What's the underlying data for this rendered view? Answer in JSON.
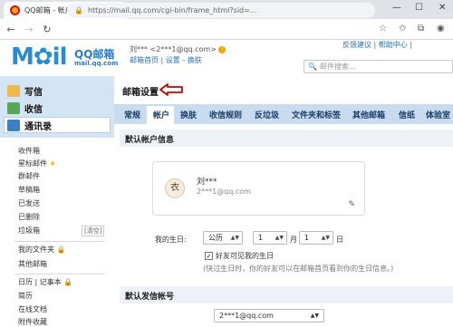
{
  "browser": {
    "tab_title": "QQ邮箱 - 帐户",
    "url": "https://mail.qq.com/cgi-bin/frame_html?sid=...",
    "icons": [
      "back-icon",
      "forward-icon",
      "reload-icon",
      "lock-icon",
      "star-icon",
      "favorites-icon",
      "collections-icon",
      "profile-icon"
    ]
  },
  "header": {
    "logo_text": "M✿il",
    "logo_cn": "QQ邮箱",
    "logo_domain": "mail.qq.com",
    "account": "刘*** <2***1@qq.com>",
    "nav_home": "邮箱首页",
    "nav_settings": "设置",
    "nav_switch": "换肤",
    "link_feedback": "反馈建议",
    "link_help": "帮助中心",
    "search_placeholder": "邮件搜索..."
  },
  "sidebar": {
    "compose": "写信",
    "inbox": "收信",
    "contacts": "通讯录",
    "items": [
      "收件箱",
      "星标邮件",
      "群邮件",
      "草稿箱",
      "已发送",
      "已删除",
      "垃圾箱"
    ],
    "trash_clear": "[清空]",
    "my_folders": "我的文件夹",
    "other_mailbox": "其他邮箱",
    "calendar": "日历",
    "notes": "记事本",
    "resume": "简历",
    "online_docs": "在线文档",
    "attachments": "附件收藏"
  },
  "main": {
    "title": "邮箱设置",
    "tabs": [
      "常规",
      "帐户",
      "换肤",
      "收信规则",
      "反垃圾",
      "文件夹和标签",
      "其他邮箱",
      "信纸",
      "体验室"
    ],
    "active_tab": "帐户",
    "section_account": "默认帐户信息",
    "card_name": "刘***",
    "card_email": "2***1@qq.com",
    "birthday_label": "我的生日:",
    "calendar_type": "公历",
    "month": "1",
    "month_unit": "月",
    "day": "1",
    "day_unit": "日",
    "friends_see_birthday": "好友可见我的生日",
    "birthday_hint": "(快过生日时，你的好友可以在邮箱首页看到你的生日信息。)",
    "section_sender": "默认发信帐号",
    "sender_account": "2***1@qq.com"
  },
  "colors": {
    "brand": "#2a8ad2",
    "tabstrip": "#c8dbef",
    "sidebar_top": "#d3e5f5",
    "annotation_arrow": "#d10000"
  }
}
